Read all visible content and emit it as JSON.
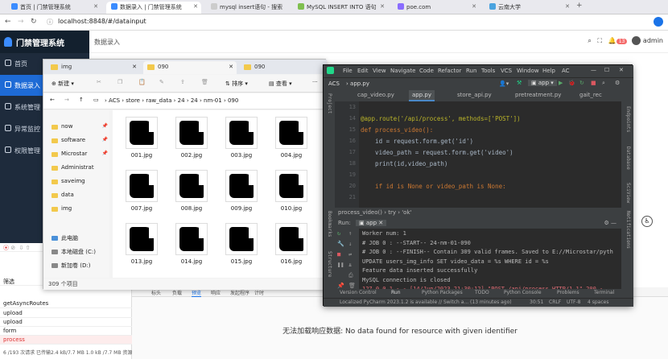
{
  "browser": {
    "tabs": [
      {
        "label": "首页 | 门禁管理系统",
        "active": false
      },
      {
        "label": "数据录入 | 门禁管理系统",
        "active": true
      },
      {
        "label": "mysql insert语句 - 搜索",
        "active": false
      },
      {
        "label": "MySQL INSERT INTO 语句",
        "active": false
      },
      {
        "label": "poe.com",
        "active": false
      },
      {
        "label": "云南大学",
        "active": false
      }
    ],
    "url": "localhost:8848/#/datainput"
  },
  "app": {
    "brand": "门禁管理系统",
    "nav": [
      {
        "label": "首页",
        "active": false
      },
      {
        "label": "数据录入",
        "active": true
      },
      {
        "label": "系统管理",
        "active": false
      },
      {
        "label": "异常监控",
        "active": false
      },
      {
        "label": "权限管理",
        "active": false
      }
    ],
    "breadcrumb": "数据录入",
    "notification_count": "13",
    "user": "admin"
  },
  "explorer": {
    "tabs": [
      "img",
      "090",
      "090"
    ],
    "toolbar": {
      "new": "新建",
      "sort": "排序",
      "view": "查看"
    },
    "path": [
      "ACS",
      "store",
      "raw_data",
      "24",
      "24",
      "nm-01",
      "090"
    ],
    "tree": [
      {
        "label": "now",
        "pinned": true
      },
      {
        "label": "software",
        "pinned": true
      },
      {
        "label": "Microstar",
        "pinned": true
      },
      {
        "label": "Administrat",
        "pinned": true
      },
      {
        "label": "saveimg",
        "pinned": false
      },
      {
        "label": "data",
        "pinned": false
      },
      {
        "label": "img",
        "pinned": false
      },
      {
        "label": "此电脑",
        "pinned": false
      },
      {
        "label": "本地磁盘 (C:)",
        "pinned": false
      },
      {
        "label": "新加卷 (D:)",
        "pinned": false
      }
    ],
    "files": [
      "001.jpg",
      "002.jpg",
      "003.jpg",
      "004.jpg",
      "007.jpg",
      "008.jpg",
      "009.jpg",
      "010.jpg",
      "013.jpg",
      "014.jpg",
      "015.jpg",
      "016.jpg"
    ],
    "status": "309 个项目"
  },
  "pycharm": {
    "menu": [
      "File",
      "Edit",
      "View",
      "Navigate",
      "Code",
      "Refactor",
      "Run",
      "Tools",
      "VCS",
      "Window",
      "Help",
      "AC"
    ],
    "project": "ACS",
    "file": "app.py",
    "run_config": "app",
    "tabs": [
      "cap_video.py",
      "app.py",
      "store_api.py",
      "pretreatment.py",
      "gait_rec"
    ],
    "line_numbers": [
      "13",
      "14",
      "15",
      "16",
      "17",
      "18",
      "19",
      "20",
      "21"
    ],
    "code": [
      "",
      "@app.route('/api/process', methods=['POST'])",
      "def process_video():",
      "    id = request.form.get('id')",
      "    video_path = request.form.get('video')",
      "    print(id,video_path)",
      "",
      "    if id is None or video_path is None:",
      ""
    ],
    "breadcrumb": "process_video()  ›  try  ›  'ok'",
    "run_label": "Run:",
    "run_tab": "app",
    "console": [
      "Worker num: 1",
      "# JOB 0 : --START-- 24-nm-01-090",
      "# JOB 0 : --FINISH-- Contain 309 valid frames. Saved to E://Microstar/pyth",
      "UPDATE users_img_info SET video_data = %s WHERE id = %s",
      "Feature data inserted successfully",
      "MySQL connection is closed",
      "127.0.0.1 - - [14/Jun/2023 21:30:12] \"POST /api/process HTTP/1.1\" 200 -"
    ],
    "bottom_tabs": [
      "Version Control",
      "Run",
      "Python Packages",
      "TODO",
      "Python Console",
      "Problems",
      "Terminal"
    ],
    "status_left": "Localized PyCharm 2023.1.2 is available // Switch a... (13 minutes ago)",
    "status_right": [
      "30:51",
      "CRLF",
      "UTF-8",
      "4 spaces"
    ],
    "side_labels": [
      "Project",
      "Structure",
      "Bookmarks"
    ],
    "right_labels": [
      "Endpoints",
      "Database",
      "SciView",
      "Notifications"
    ]
  },
  "devtools": {
    "rows": [
      "筛选",
      "getAsyncRoutes",
      "upload",
      "upload",
      "form",
      "process"
    ],
    "status": "6 /193 次请求  已传输2.4 kB/7.7 MB  1.0 kB /7.7 MB 资源",
    "tabs": [
      "标头",
      "负载",
      "预览",
      "响应",
      "发起程序",
      "计时"
    ],
    "message": "无法加载响应数据: No data found for resource with given identifier"
  },
  "colors": {
    "accent": "#1e6bd6",
    "sidebar": "#1e2b3c",
    "ide_bg": "#2b2b2b",
    "error": "#f56c6c"
  }
}
